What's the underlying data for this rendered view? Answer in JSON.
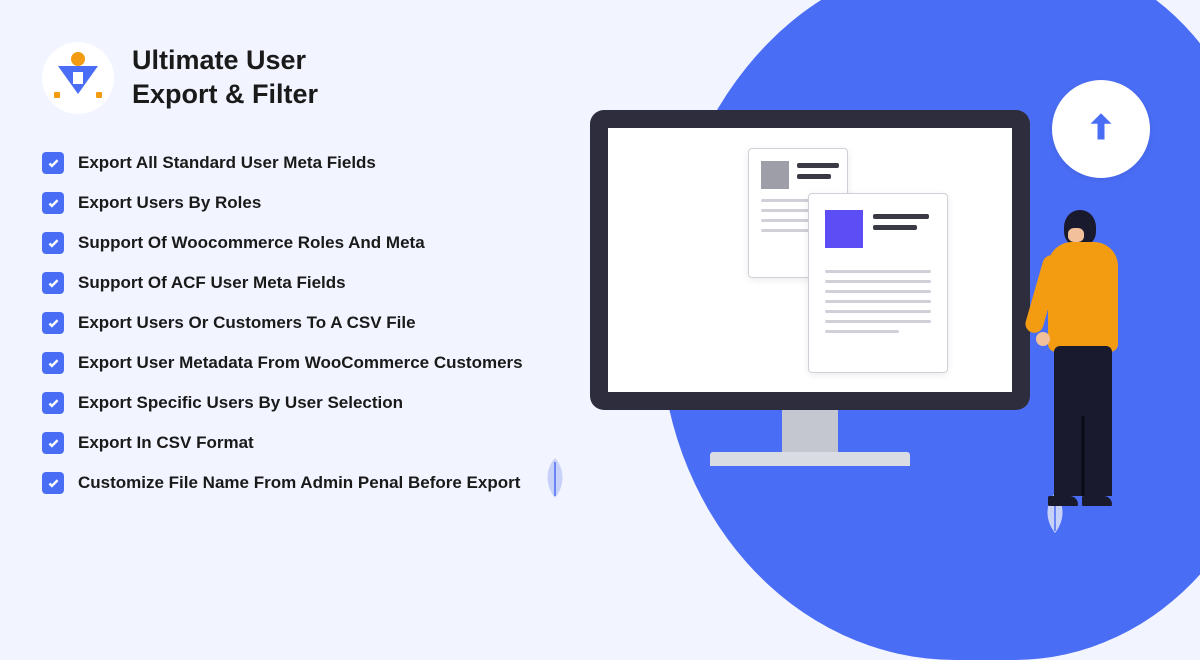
{
  "title_line1": "Ultimate User",
  "title_line2": "Export & Filter",
  "features": [
    "Export All Standard User Meta Fields",
    "Export Users By Roles",
    "Support Of Woocommerce Roles And Meta",
    "Support Of ACF User Meta Fields",
    "Export Users Or Customers To A CSV File",
    "Export User Metadata From WooCommerce Customers",
    "Export Specific Users By User Selection",
    "Export In CSV Format",
    "Customize File Name From Admin Penal Before Export"
  ]
}
